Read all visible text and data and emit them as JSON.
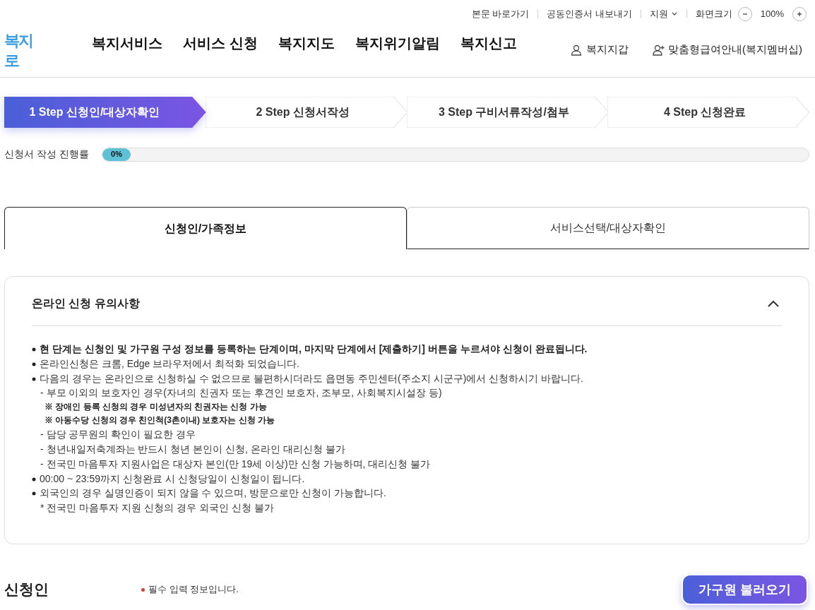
{
  "utility_links": [
    "본문 바로가기",
    "공동인증서 내보내기",
    "지원"
  ],
  "zoom": {
    "label": "화면크기",
    "value": "100%"
  },
  "logo": "복지로",
  "nav": [
    "복지서비스",
    "서비스 신청",
    "복지지도",
    "복지위기알림",
    "복지신고"
  ],
  "account_links": [
    "복지지갑",
    "맞춤형급여안내(복지멤버십)"
  ],
  "steps": [
    {
      "label": "1 Step 신청인/대상자확인",
      "selected": true
    },
    {
      "label": "2 Step 신청서작성",
      "selected": false
    },
    {
      "label": "3 Step 구비서류작성/첨부",
      "selected": false
    },
    {
      "label": "4 Step 신청완료",
      "selected": false
    }
  ],
  "progress": {
    "label": "신청서 작성 진행률",
    "level": 0,
    "reading": "0%"
  },
  "tabs": [
    {
      "label": "신청인/가족정보",
      "selected": true
    },
    {
      "label": "서비스선택/대상자확인",
      "selected": false
    }
  ],
  "notice": {
    "title": "온라인 신청 유의사항",
    "expanded": true,
    "lines": [
      {
        "kind": "lead",
        "text": "현 단계는 신청인 및 가구원 구성 정보를 등록하는 단계이며, 마지막 단계에서 [제출하기] 버튼을 누르셔야 신청이 완료됩니다."
      },
      {
        "kind": "bullet",
        "text": "온라인신청은 크롬, Edge 브라우저에서 최적화 되었습니다."
      },
      {
        "kind": "bullet",
        "text": "다음의 경우는 온라인으로 신청하실 수 없으므로 불편하시더라도 읍면동 주민센터(주소지 시군구)에서 신청하시기 바랍니다."
      },
      {
        "kind": "dash",
        "text": "- 부모 이외의 보호자인 경우(자녀의 친권자 또는 후견인 보호자, 조부모, 사회복지시설장 등)"
      },
      {
        "kind": "note",
        "text": "※ 장애인 등록 신청의 경우 미성년자의 친권자는 신청 가능"
      },
      {
        "kind": "note",
        "text": "※ 아동수당 신청의 경우 친인척(3촌이내) 보호자는 신청 가능"
      },
      {
        "kind": "dash",
        "text": "- 담당 공무원의 확인이 필요한 경우"
      },
      {
        "kind": "dash",
        "text": "- 청년내일저축계좌는 반드시 청년 본인이 신청, 온라인 대리신청 불가"
      },
      {
        "kind": "dash",
        "text": "- 전국민 마음투자 지원사업은 대상자 본인(만 19세 이상)만 신청 가능하며, 대리신청 불가"
      },
      {
        "kind": "bullet",
        "text": "00:00 ~ 23:59까지 신청완료 시 신청당일이 신청일이 됩니다."
      },
      {
        "kind": "bullet",
        "text": "외국인의 경우 실명인증이 되지 않을 수 있으며, 방문으로만 신청이 가능합니다."
      },
      {
        "kind": "dash",
        "text": "* 전국민 마음투자 지원 신청의 경우 외국인 신청 불가"
      }
    ]
  },
  "applicant": {
    "title": "신청인",
    "required_note": "필수 입력 정보입니다.",
    "button": "가구원 불러오기"
  }
}
